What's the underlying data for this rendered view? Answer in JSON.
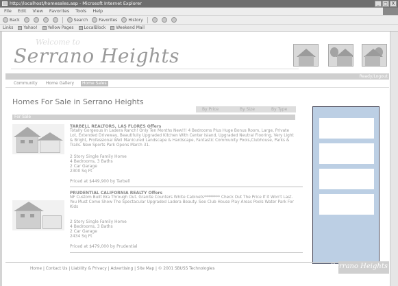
{
  "browser": {
    "title": "http://localhost/homesales.asp - Microsoft Internet Explorer",
    "window_buttons": [
      "_",
      "□",
      "X"
    ],
    "menu": [
      "File",
      "Edit",
      "View",
      "Favorites",
      "Tools",
      "Help"
    ],
    "toolbar": [
      "Back",
      "Search",
      "Favorites",
      "History"
    ],
    "links_label": "Links",
    "links": [
      "Yahoo!",
      "Yellow Pages",
      "LocalBlock",
      "Weekend Mail"
    ]
  },
  "header": {
    "welcome": "Welcome to",
    "site_title": "Serrano Heights",
    "status_link": "Ready/Logout"
  },
  "nav": {
    "tabs": [
      "Community",
      "Home Gallery",
      "Home Sales"
    ],
    "active_index": 2
  },
  "main": {
    "heading": "Homes For Sale in Serrano Heights",
    "sort": [
      "By Price",
      "By Size",
      "By Type"
    ],
    "section_label": "For Sale"
  },
  "listings": [
    {
      "title": "TARBELL REALTORS, LAS FLORES Offers",
      "description": "Totally Gorgeous In Ladera Ranch! Only Ten Months New!!! 4 Bedrooms Plus Huge Bonus Room, Large, Private Lot, Extended Driveway, Beautifully Upgraded Kitchen With Center Island, Upgraded Neutral Flooring, Very Light & Bright, Professional Well Manicured Landscape & Hardscape, Fantastic Community Pools,Clubhouse, Parks & Trails. New Sports Park Opens March 31.",
      "specs": [
        "2 Story Single Family Home",
        "4 Bedrooms, 3 Baths",
        "2 Car Garage",
        "2300 Sq Ft"
      ],
      "price": "Priced at $449,900 by Tarbell"
    },
    {
      "title": "PRUDENTIAL CALIFORNIA REALTY Offers",
      "description": "NF Custom Built Bra Through Out. Granite Counters White Cabinets******** Check Out The Price If It Won't Last. You Must Come Show The Spectacular Upgraded Ladera Beauty. See Club House Play Areas Pools Water Park For Kids",
      "specs": [
        "2 Story Single Family Home",
        "4 Bedrooms, 3 Baths",
        "2 Car Garage",
        "2434 Sq Ft"
      ],
      "price": "Priced at $479,000 by Prudential"
    }
  ],
  "footer": {
    "links": "Home | Contact Us | Liability & Privacy | Advertising | Site Map | © 2001 SBUSS Technologies",
    "logo_text": "Serrano Heights"
  },
  "colors": {
    "sidebar_bg": "#bccfe4",
    "bar_gray": "#cfcfcf"
  }
}
